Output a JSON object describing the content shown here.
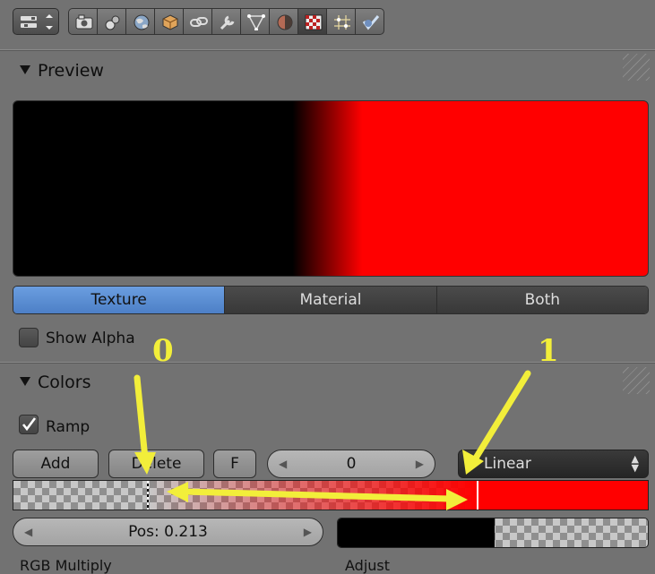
{
  "toolbar": {
    "editor_type_icon": "properties-editor-icon",
    "tabs": [
      {
        "icon": "render-icon",
        "active": false
      },
      {
        "icon": "render-layers-icon",
        "active": false
      },
      {
        "icon": "world-icon",
        "active": false
      },
      {
        "icon": "object-icon",
        "active": false
      },
      {
        "icon": "constraints-icon",
        "active": false
      },
      {
        "icon": "modifiers-icon",
        "active": false
      },
      {
        "icon": "object-data-icon",
        "active": false
      },
      {
        "icon": "material-icon",
        "active": false
      },
      {
        "icon": "texture-icon",
        "active": true
      },
      {
        "icon": "particles-icon",
        "active": false
      },
      {
        "icon": "physics-icon",
        "active": false
      }
    ]
  },
  "preview": {
    "title": "Preview",
    "gradient_colors": [
      "#000000",
      "#ff0000"
    ],
    "tabs": [
      "Texture",
      "Material",
      "Both"
    ],
    "active_tab": "Texture",
    "show_alpha_label": "Show Alpha",
    "show_alpha_checked": false
  },
  "colors": {
    "title": "Colors",
    "ramp_label": "Ramp",
    "ramp_checked": true,
    "add_label": "Add",
    "delete_label": "Delete",
    "flip_label": "F",
    "active_index": "0",
    "interpolation": "Linear",
    "pos_label": "Pos: 0.213",
    "stops": [
      {
        "pos": 0.213,
        "color": "#000000",
        "alpha": 0
      },
      {
        "pos": 0.73,
        "color": "#ff0000",
        "alpha": 1
      }
    ]
  },
  "cutoff": {
    "left_text": "RGB Multiply",
    "right_text": "Adjust"
  },
  "annotations": {
    "label_0": "0",
    "label_1": "1",
    "color": "#f2ee3a"
  }
}
